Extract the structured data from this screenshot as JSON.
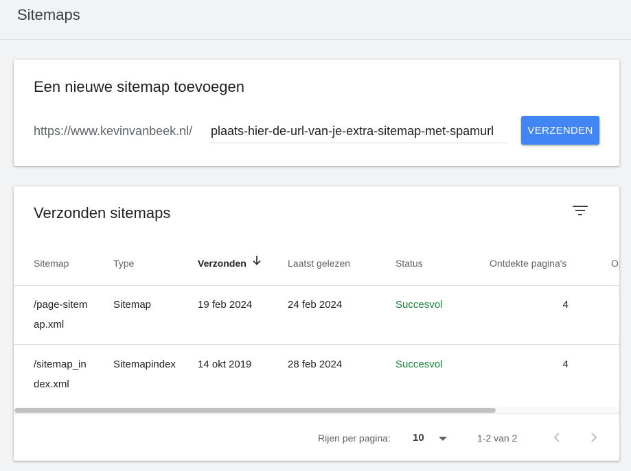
{
  "page": {
    "title": "Sitemaps"
  },
  "add_sitemap": {
    "title": "Een nieuwe sitemap toevoegen",
    "url_prefix": "https://www.kevinvanbeek.nl/",
    "input_value": "plaats-hier-de-url-van-je-extra-sitemap-met-spamurl",
    "submit_label": "VERZENDEN",
    "accent_color": "#4285f4"
  },
  "submitted": {
    "title": "Verzonden sitemaps",
    "filter_icon": "filter-list-icon",
    "columns": {
      "sitemap": "Sitemap",
      "type": "Type",
      "submitted": "Verzonden",
      "last_read": "Laatst gelezen",
      "status": "Status",
      "discovered": "Ontdekte pagina's",
      "more": "On"
    },
    "sort_icon": "arrow-down-icon",
    "rows": [
      {
        "sitemap_line1": "/page-sitem",
        "sitemap_line2": "ap.xml",
        "type": "Sitemap",
        "submitted": "19 feb 2024",
        "last_read": "24 feb 2024",
        "status": "Succesvol",
        "discovered": "4"
      },
      {
        "sitemap_line1": "/sitemap_in",
        "sitemap_line2": "dex.xml",
        "type": "Sitemapindex",
        "submitted": "14 okt 2019",
        "last_read": "28 feb 2024",
        "status": "Succesvol",
        "discovered": "4"
      }
    ],
    "status_color": "#188038",
    "pagination": {
      "rows_per_page_label": "Rijen per pagina:",
      "rows_per_page_value": "10",
      "range": "1-2 van 2",
      "prev_icon": "chevron-left-icon",
      "next_icon": "chevron-right-icon"
    }
  }
}
